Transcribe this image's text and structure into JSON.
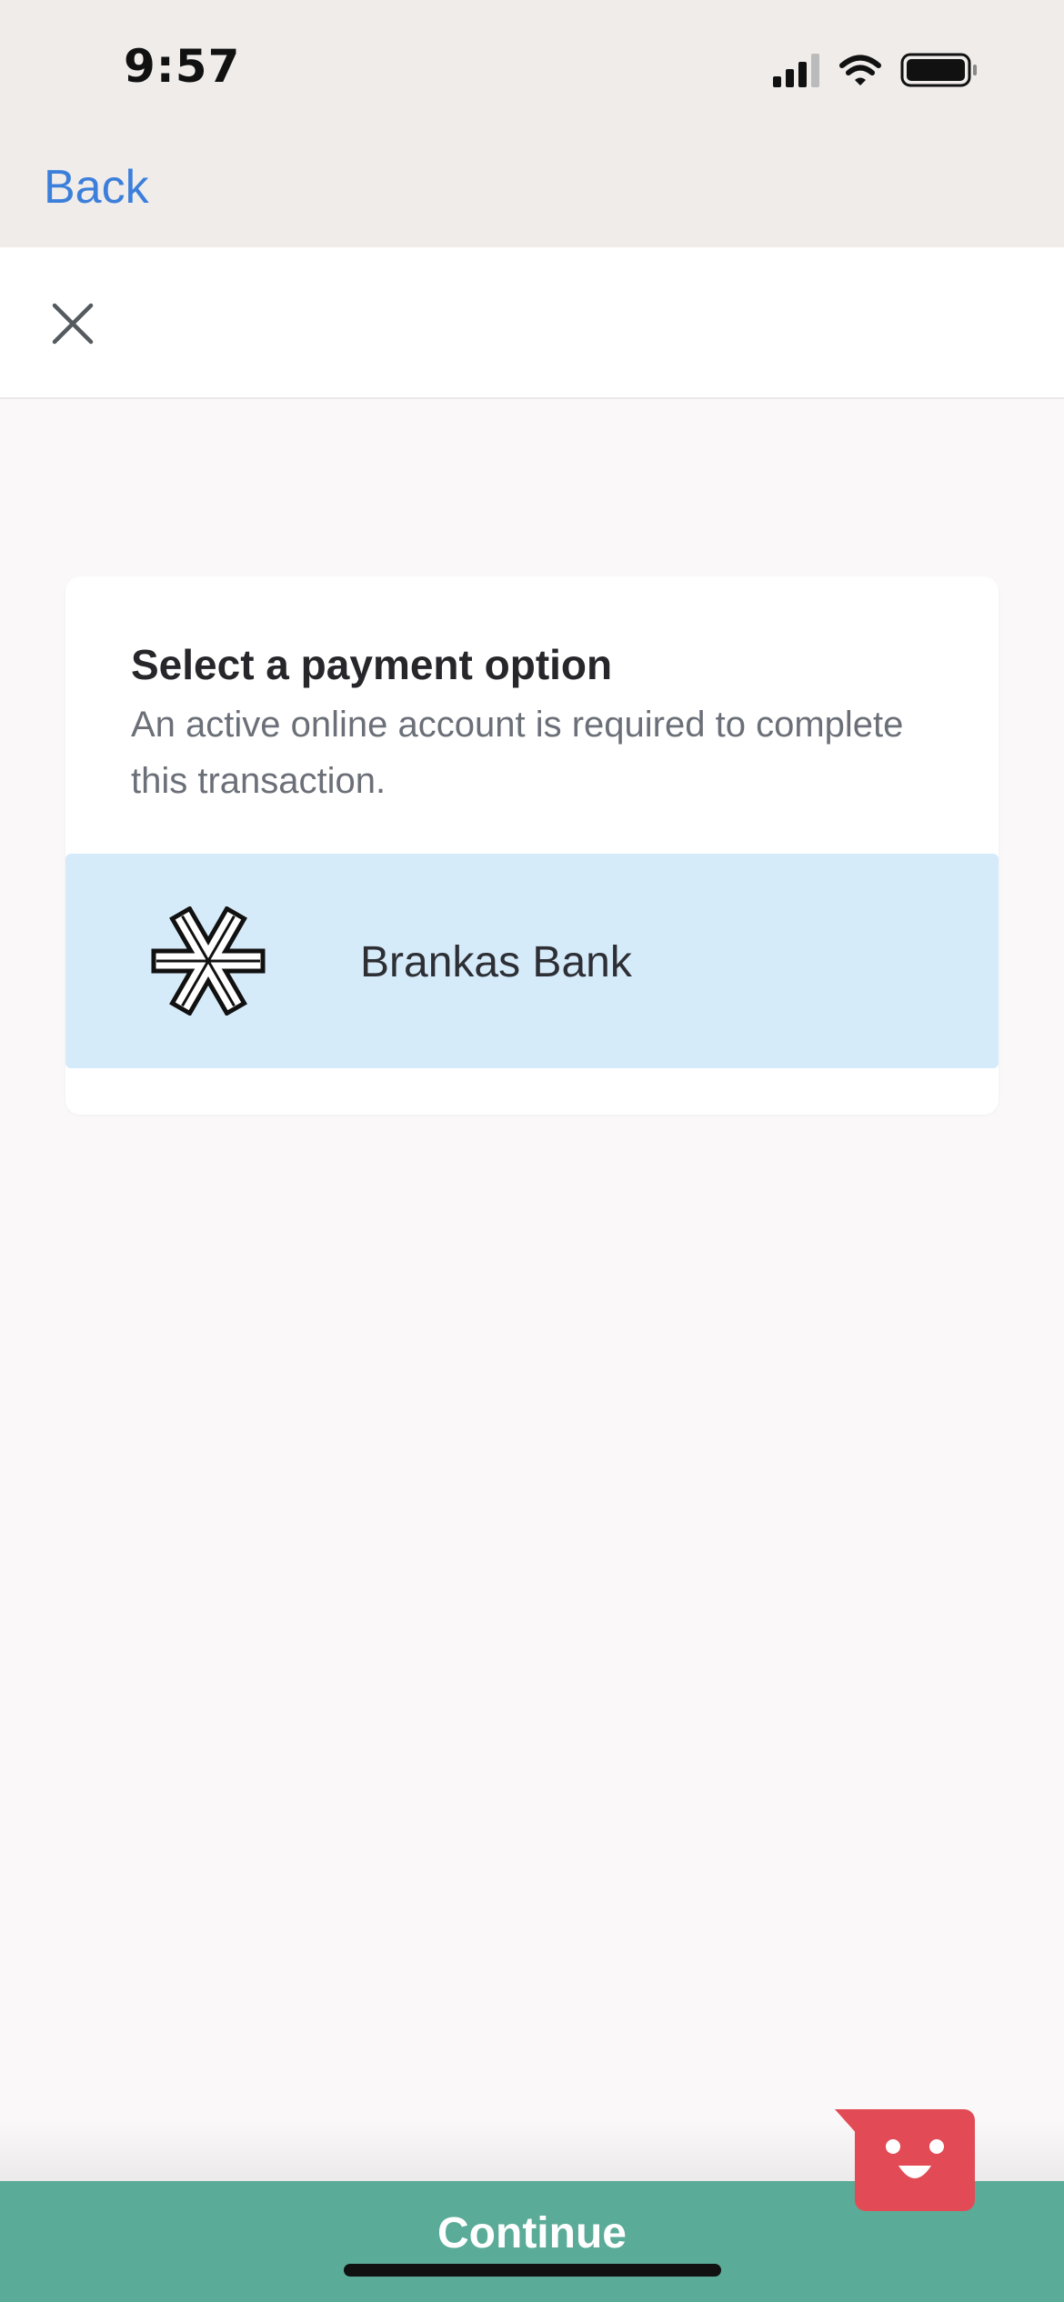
{
  "status_bar": {
    "time": "9:57",
    "icons": [
      "cellular-signal-icon",
      "wifi-icon",
      "battery-icon"
    ]
  },
  "nav": {
    "back_label": "Back"
  },
  "header": {
    "close_icon": "close-icon"
  },
  "card": {
    "title": "Select a payment option",
    "description": "An active online account is required to complete this transaction.",
    "options": [
      {
        "label": "Brankas Bank",
        "icon": "brankas-logo-icon"
      }
    ]
  },
  "footer": {
    "continue_label": "Continue"
  },
  "chat": {
    "icon": "smiley-chat-icon"
  },
  "colors": {
    "accent": "#3c7fdb",
    "option_selected_bg": "#d6ebfa",
    "continue_bg": "#5aab97",
    "chat_bg": "#e24b55",
    "nav_bg": "#efecea"
  }
}
